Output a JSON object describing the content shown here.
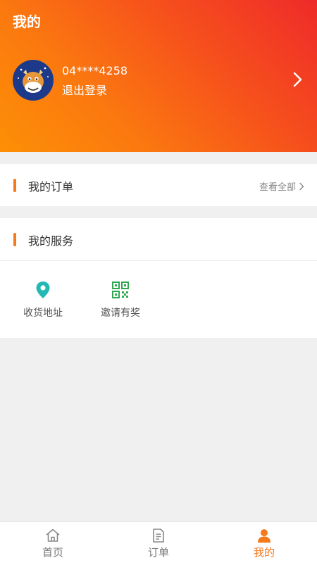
{
  "header": {
    "title": "我的",
    "user": {
      "id": "04****4258",
      "logout_label": "退出登录",
      "avatar_icon": "cow-mascot-avatar"
    }
  },
  "orders": {
    "title": "我的订单",
    "view_all": "查看全部"
  },
  "services": {
    "title": "我的服务",
    "items": [
      {
        "label": "收货地址",
        "icon": "location-pin-icon",
        "color": "#22b8b3"
      },
      {
        "label": "邀请有奖",
        "icon": "qr-code-icon",
        "color": "#2fa84f"
      }
    ]
  },
  "tabbar": {
    "tabs": [
      {
        "label": "首页",
        "icon": "home-icon",
        "active": false
      },
      {
        "label": "订单",
        "icon": "document-icon",
        "active": false
      },
      {
        "label": "我的",
        "icon": "user-icon",
        "active": true
      }
    ]
  },
  "colors": {
    "accent": "#f47a1c",
    "header_gradient_start": "#fd8f06",
    "header_gradient_end": "#ee2a2a",
    "background": "#f0f0f0"
  }
}
